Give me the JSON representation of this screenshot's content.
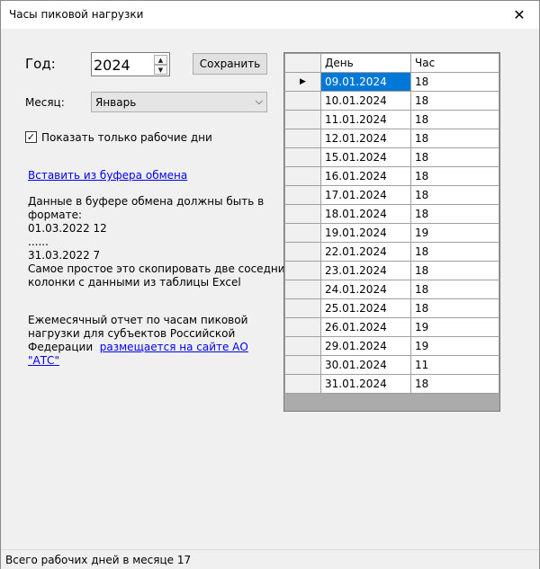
{
  "window": {
    "title": "Часы пиковой нагрузки"
  },
  "form": {
    "year_label": "Год:",
    "year_value": "2024",
    "save_label": "Сохранить",
    "month_label": "Месяц:",
    "month_value": "Январь",
    "workdays_only_label": "Показать только рабочие дни",
    "workdays_only_checked": true
  },
  "clipboard": {
    "paste_link": "Вставить из буфера обмена",
    "hint_line1": "Данные в буфере обмена должны быть в",
    "hint_line2": "формате:",
    "hint_line3": "01.03.2022 12",
    "hint_line4": "......",
    "hint_line5": "31.03.2022 7",
    "hint_line6": "Самое простое это скопировать две соседние",
    "hint_line7": "колонки с данными из таблицы Excel"
  },
  "report": {
    "line1": "Ежемесячный отчет по часам пиковой",
    "line2": "нагрузки для субъектов Российской",
    "line3_text": "Федерации",
    "line3_link": "размещается на сайте АО",
    "line4_link": "\"АТС\""
  },
  "grid": {
    "columns": [
      "День",
      "Час"
    ],
    "rows": [
      {
        "day": "09.01.2024",
        "hour": "18"
      },
      {
        "day": "10.01.2024",
        "hour": "18"
      },
      {
        "day": "11.01.2024",
        "hour": "18"
      },
      {
        "day": "12.01.2024",
        "hour": "18"
      },
      {
        "day": "15.01.2024",
        "hour": "18"
      },
      {
        "day": "16.01.2024",
        "hour": "18"
      },
      {
        "day": "17.01.2024",
        "hour": "18"
      },
      {
        "day": "18.01.2024",
        "hour": "18"
      },
      {
        "day": "19.01.2024",
        "hour": "19"
      },
      {
        "day": "22.01.2024",
        "hour": "18"
      },
      {
        "day": "23.01.2024",
        "hour": "18"
      },
      {
        "day": "24.01.2024",
        "hour": "18"
      },
      {
        "day": "25.01.2024",
        "hour": "18"
      },
      {
        "day": "26.01.2024",
        "hour": "19"
      },
      {
        "day": "29.01.2024",
        "hour": "19"
      },
      {
        "day": "30.01.2024",
        "hour": "11"
      },
      {
        "day": "31.01.2024",
        "hour": "18"
      }
    ]
  },
  "status": {
    "text": "Всего рабочих дней в месяце 17"
  },
  "colors": {
    "selection": "#0078d7",
    "link": "#0000ee",
    "background": "#f0f0f0"
  }
}
